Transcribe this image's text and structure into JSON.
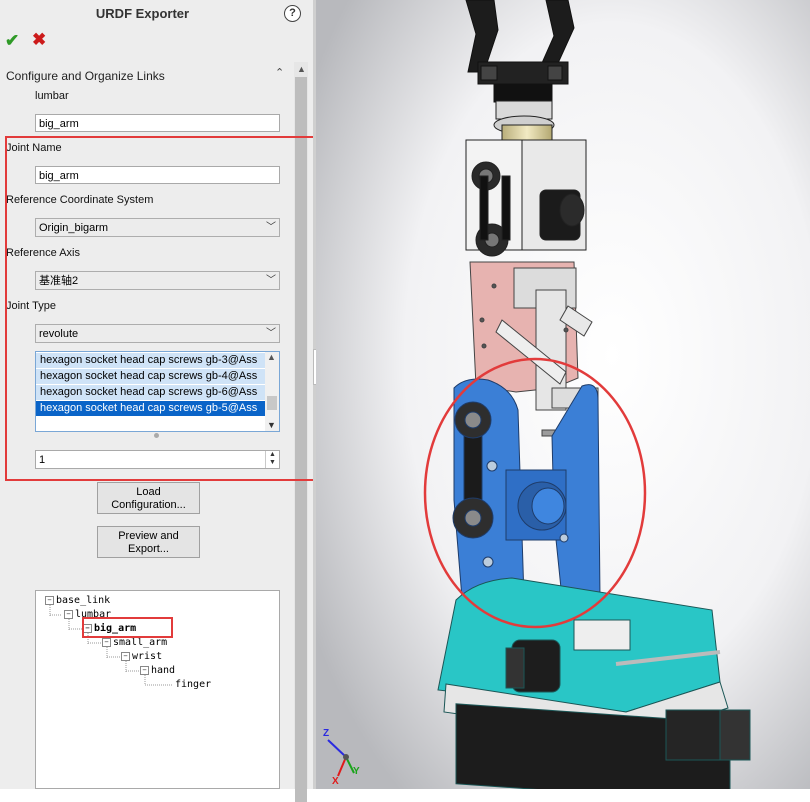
{
  "window": {
    "title": "URDF Exporter",
    "help_icon": "?"
  },
  "actions": {
    "ok_icon": "✔",
    "cancel_icon": "✖"
  },
  "section": {
    "title": "Configure and Organize Links",
    "collapse_icon": "⌃"
  },
  "link": {
    "name_label": "lumbar",
    "name_value": "big_arm"
  },
  "joint": {
    "name_label": "Joint Name",
    "name_value": "big_arm",
    "ref_coord_label": "Reference Coordinate System",
    "ref_coord_value": "Origin_bigarm",
    "ref_axis_label": "Reference Axis",
    "ref_axis_value": "基准轴2",
    "type_label": "Joint Type",
    "type_value": "revolute"
  },
  "components": [
    {
      "label": "hexagon socket head cap screws gb-3@Ass",
      "selected": false
    },
    {
      "label": "hexagon socket head cap screws gb-4@Ass",
      "selected": false
    },
    {
      "label": "hexagon socket head cap screws gb-6@Ass",
      "selected": false
    },
    {
      "label": "hexagon socket head cap screws gb-5@Ass",
      "selected": true
    }
  ],
  "child_count": "1",
  "buttons": {
    "load_config": "Load\nConfiguration...",
    "preview_export": "Preview and\nExport..."
  },
  "tree": {
    "base_link": "base_link",
    "lumbar": "lumbar",
    "big_arm": "big_arm",
    "small_arm": "small_arm",
    "wrist": "wrist",
    "hand": "hand",
    "finger": "finger",
    "expander": "−"
  },
  "triad": {
    "z": "Z",
    "y": "Y",
    "x": "X"
  },
  "colors": {
    "annotation_red": "#e23b3b",
    "selection_blue": "#0a64c8",
    "link_blue": "#3b7fd6",
    "base_cyan": "#29c6c6"
  }
}
